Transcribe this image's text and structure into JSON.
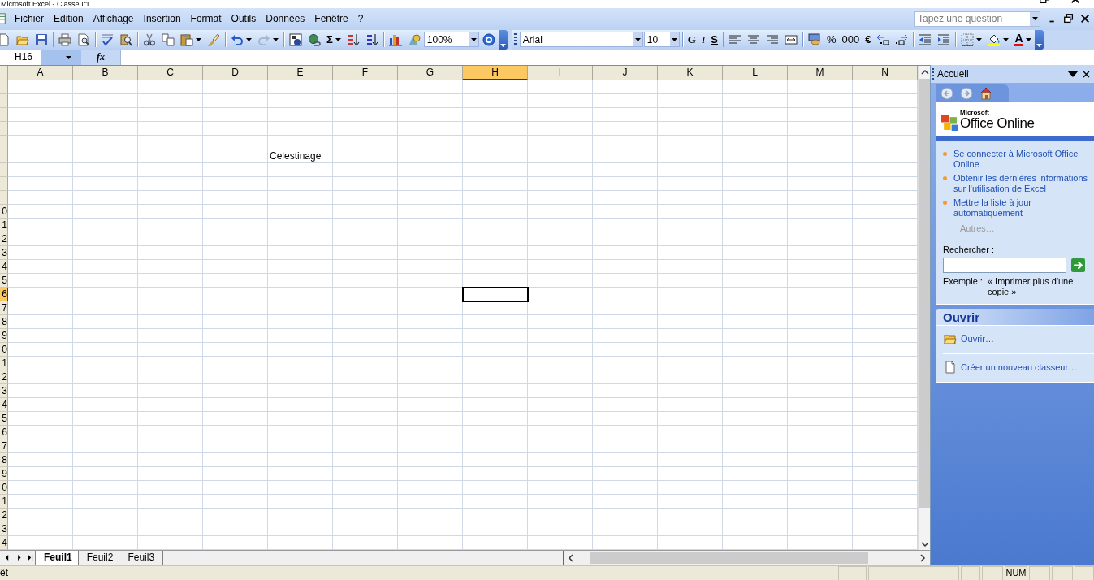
{
  "window": {
    "title": "Microsoft Excel - Classeur1"
  },
  "menu": [
    "Fichier",
    "Edition",
    "Affichage",
    "Insertion",
    "Format",
    "Outils",
    "Données",
    "Fenêtre",
    "?"
  ],
  "help_search": {
    "placeholder": "Tapez une question"
  },
  "standard_toolbar": {
    "autosum": "Σ",
    "zoom": "100%"
  },
  "format_toolbar": {
    "font": "Arial",
    "size": "10",
    "bold": "G",
    "italic": "I",
    "underline": "S",
    "percent": "%",
    "thousands": "000",
    "euro": "€",
    "font_color": "A"
  },
  "formula_bar": {
    "name_box": "H16",
    "function_label": "fx"
  },
  "sheet": {
    "columns": [
      {
        "label": "A",
        "selected": false
      },
      {
        "label": "B",
        "selected": false
      },
      {
        "label": "C",
        "selected": false
      },
      {
        "label": "D",
        "selected": false
      },
      {
        "label": "E",
        "selected": false
      },
      {
        "label": "F",
        "selected": false
      },
      {
        "label": "G",
        "selected": false
      },
      {
        "label": "H",
        "selected": true
      },
      {
        "label": "I",
        "selected": false
      },
      {
        "label": "J",
        "selected": false
      },
      {
        "label": "K",
        "selected": false
      },
      {
        "label": "L",
        "selected": false
      },
      {
        "label": "M",
        "selected": false
      },
      {
        "label": "N",
        "selected": false
      }
    ],
    "rows": [
      {
        "selected": false
      },
      {
        "selected": false
      },
      {
        "selected": false
      },
      {
        "selected": false
      },
      {
        "selected": false
      },
      {
        "selected": false,
        "cells": {
          "E": "Celestinage"
        }
      },
      {
        "selected": false
      },
      {
        "selected": false
      },
      {
        "selected": false
      },
      {
        "label": "0",
        "selected": false
      },
      {
        "label": "1",
        "selected": false
      },
      {
        "label": "2",
        "selected": false
      },
      {
        "label": "3",
        "selected": false
      },
      {
        "label": "4",
        "selected": false
      },
      {
        "label": "5",
        "selected": false
      },
      {
        "label": "6",
        "selected": true
      },
      {
        "label": "7",
        "selected": false
      },
      {
        "label": "8",
        "selected": false
      },
      {
        "label": "9",
        "selected": false
      },
      {
        "label": "0",
        "selected": false
      },
      {
        "label": "1",
        "selected": false
      },
      {
        "label": "2",
        "selected": false
      },
      {
        "label": "3",
        "selected": false
      },
      {
        "label": "4",
        "selected": false
      },
      {
        "label": "5",
        "selected": false
      },
      {
        "label": "6",
        "selected": false
      },
      {
        "label": "7",
        "selected": false
      },
      {
        "label": "8",
        "selected": false
      },
      {
        "label": "9",
        "selected": false
      },
      {
        "label": "0",
        "selected": false
      },
      {
        "label": "1",
        "selected": false
      },
      {
        "label": "2",
        "selected": false
      },
      {
        "label": "3",
        "selected": false
      },
      {
        "label": "4",
        "selected": false
      }
    ]
  },
  "sheet_tabs": [
    {
      "label": "Feuil1",
      "selected": true
    },
    {
      "label": "Feuil2",
      "selected": false
    },
    {
      "label": "Feuil3",
      "selected": false
    }
  ],
  "task_pane": {
    "title": "Accueil",
    "logo": {
      "small": "Microsoft",
      "large": "Office Online"
    },
    "links": [
      "Se connecter à Microsoft Office Online",
      "Obtenir les dernières informations sur l'utilisation de Excel",
      "Mettre la liste à jour automatiquement"
    ],
    "more": {
      "label": "Autres…",
      "disabled": true
    },
    "search_label": "Rechercher :",
    "example_label": "Exemple :",
    "example": "« Imprimer plus d'une copie »",
    "open_section": {
      "title": "Ouvrir",
      "items": [
        {
          "label": "Ouvrir…",
          "kind": "folder"
        },
        {
          "label": "Créer un nouveau classeur…",
          "kind": "document"
        }
      ]
    }
  },
  "status_bar": {
    "text": "êt",
    "indicator": "NUM"
  }
}
